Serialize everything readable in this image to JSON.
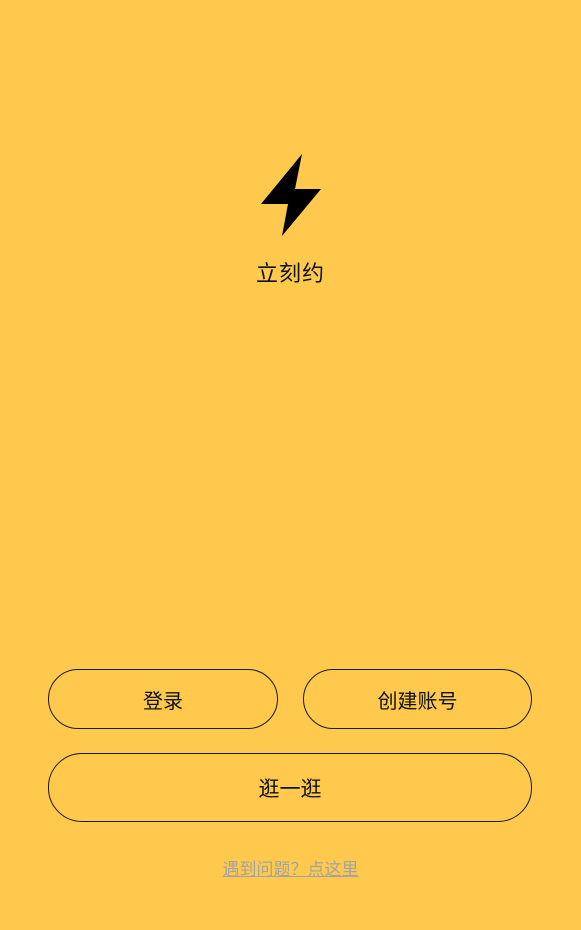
{
  "app": {
    "logo_icon": "lightning-bolt-icon",
    "name": "立刻约",
    "background_color": "#FFC94E"
  },
  "actions": {
    "login_label": "登录",
    "register_label": "创建账号",
    "browse_label": "逛一逛"
  },
  "help": {
    "link_text": "遇到问题？点这里",
    "link_color": "#A3A3A3"
  }
}
